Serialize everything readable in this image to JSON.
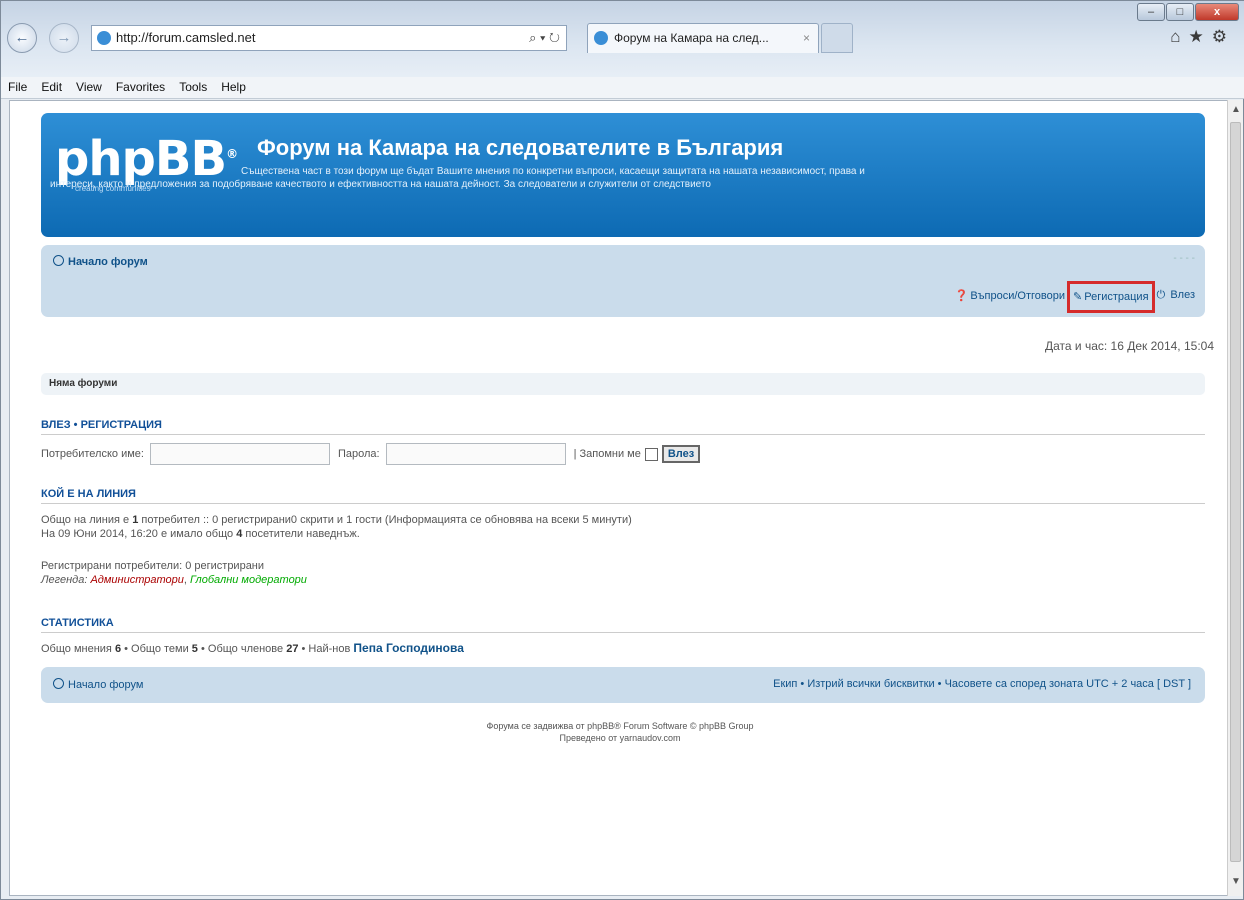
{
  "browser": {
    "window_controls": {
      "minimize": "–",
      "maximize": "□",
      "close": "x"
    },
    "back_icon": "←",
    "forward_icon": "→",
    "address": "http://forum.camsled.net",
    "address_controls": "⌕ ▾ ↻",
    "tab_title": "Форум на Камара на след...",
    "tab_close": "×",
    "toolbar_icons": "⌂★⚙",
    "menu": [
      "File",
      "Edit",
      "View",
      "Favorites",
      "Tools",
      "Help"
    ]
  },
  "header": {
    "logo": "phpBB",
    "logo_mark": "®",
    "tagline": "creating communities",
    "site_title": "Форум на Камара на следователите в България",
    "site_description": "Съществена част в този форум ще бъдат Вашите мнения по конкретни въпроси, касаещи защитата на нашата независимост, права и интереси, както и предложения за подобряване качеството и ефективността на нашата дейност. За следователи и служители от следствието"
  },
  "nav": {
    "breadcrumb": "Начало форум",
    "font_size": "- - - -",
    "faq": "Въпроси/Отговори",
    "register": "Регистрация",
    "login": "Влез"
  },
  "datetime": "Дата и час: 16 Дек 2014, 15:04",
  "no_forums": "Няма форуми",
  "login_section": {
    "heading": "Влез • Регистрация",
    "username_label": "Потребителско име:",
    "password_label": "Парола:",
    "remember_label": "| Запомни ме",
    "submit": "Влез"
  },
  "online": {
    "heading": "Кой е на линия",
    "line1_a": "Общо на линия е ",
    "line1_count": "1",
    "line1_b": " потребител :: 0 регистрирани0 скрити и 1 гости (Информацията се обновява на всеки 5 минути)",
    "line2_a": "На 09 Юни 2014, 16:20 е имало общо ",
    "line2_count": "4",
    "line2_b": " посетители наведнъж.",
    "registered": "Регистрирани потребители: 0 регистрирани",
    "legend_label": "Легенда:",
    "legend_admin": "Администратори",
    "legend_gmod": "Глобални модератори"
  },
  "stats": {
    "heading": "Статистика",
    "posts_label": "Общо мнения ",
    "posts": "6",
    "topics_label": " • Общо теми ",
    "topics": "5",
    "members_label": " • Общо членове ",
    "members": "27",
    "newest_label": " • Най-нов ",
    "newest": "Пепа Господинова"
  },
  "footer_nav": {
    "breadcrumb": "Начало форум",
    "links": "Екип • Изтрий всички бисквитки • Часовете са според зоната UTC + 2 часа [ DST ]"
  },
  "copyright": {
    "line1": "Форума се задвижва от phpBB® Forum Software © phpBB Group",
    "line2": "Преведено от yarnaudov.com"
  }
}
